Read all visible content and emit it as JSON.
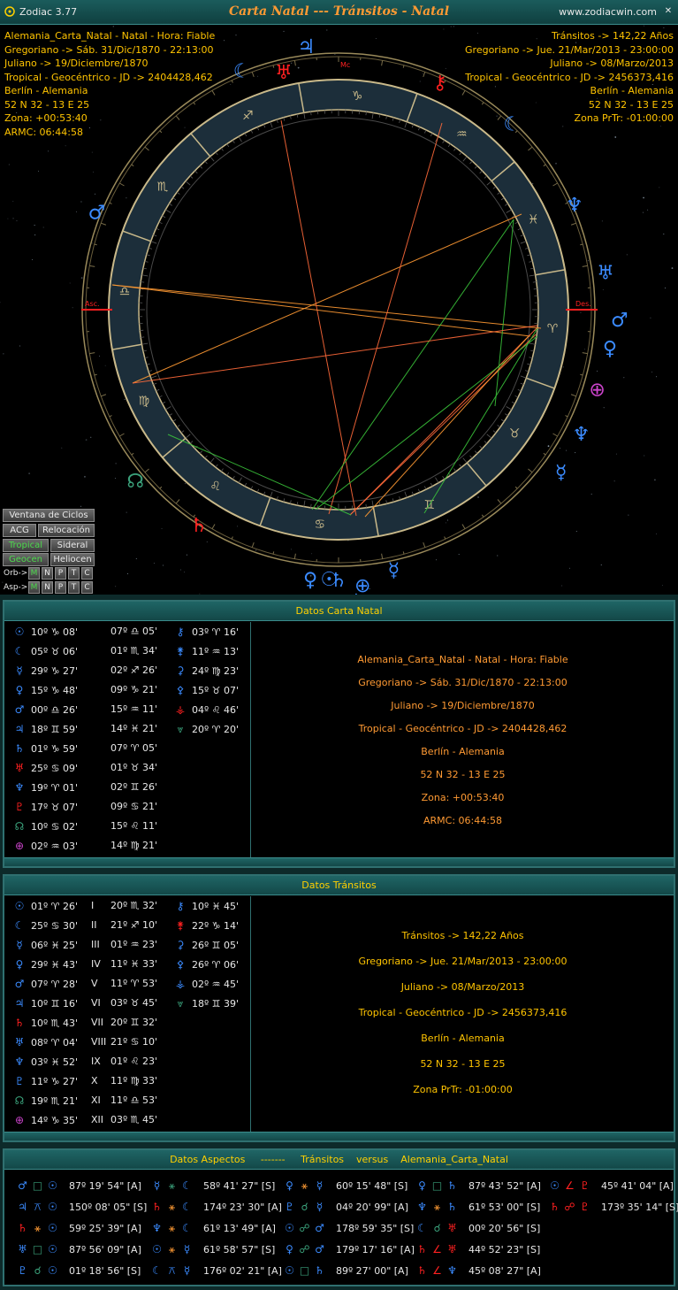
{
  "window": {
    "app_name": "Zodiac 3.77",
    "title": "Carta Natal --- Tránsitos - Natal",
    "site": "www.zodiacwin.com"
  },
  "natal_info": [
    "Alemania_Carta_Natal - Natal - Hora: Fiable",
    "Gregoriano -> Sáb. 31/Dic/1870 - 22:13:00",
    "Juliano -> 19/Diciembre/1870",
    "Tropical - Geocéntrico - JD -> 2404428,462",
    "Berlín - Alemania",
    "52 N 32 - 13 E 25",
    "Zona: +00:53:40",
    "ARMC: 06:44:58"
  ],
  "transit_info": [
    "Tránsitos -> 142,22 Años",
    "Gregoriano -> Jue. 21/Mar/2013 - 23:00:00",
    "Juliano -> 08/Marzo/2013",
    "Tropical - Geocéntrico - JD -> 2456373,416",
    "Berlín - Alemania",
    "52 N 32 - 13 E 25",
    "Zona PrTr: -01:00:00"
  ],
  "wheel": {
    "asc_label": "Asc.",
    "des_label": "Des.",
    "mc_label": "Mc",
    "signs_ccw_from_aries": [
      "♈",
      "♉",
      "♊",
      "♋",
      "♌",
      "♍",
      "♎",
      "♏",
      "♐",
      "♑",
      "♒",
      "♓"
    ],
    "outer_glyphs": [
      {
        "g": "☾",
        "c": "#3b8bff"
      },
      {
        "g": "♅",
        "c": "#ff2020"
      },
      {
        "g": "♃",
        "c": "#3b8bff"
      },
      {
        "g": "⚷",
        "c": "#ff2020"
      },
      {
        "g": "☾",
        "c": "#3b8bff"
      },
      {
        "g": "♆",
        "c": "#3b8bff"
      },
      {
        "g": "♅",
        "c": "#3b8bff"
      },
      {
        "g": "♂",
        "c": "#3b8bff"
      },
      {
        "g": "♀",
        "c": "#3b8bff"
      },
      {
        "g": "⊕",
        "c": "#cc44cc"
      },
      {
        "g": "♆",
        "c": "#3b8bff"
      },
      {
        "g": "☿",
        "c": "#3b8bff"
      },
      {
        "g": "♄",
        "c": "#3b8bff"
      },
      {
        "g": "♄",
        "c": "#3b8bff"
      },
      {
        "g": "☉",
        "c": "#3b8bff"
      },
      {
        "g": "♀",
        "c": "#3b8bff"
      },
      {
        "g": "☿",
        "c": "#3b8bff"
      },
      {
        "g": "⊕",
        "c": "#3b8bff"
      },
      {
        "g": "♄",
        "c": "#ff2020"
      },
      {
        "g": "☊",
        "c": "#3aa07a"
      },
      {
        "g": "♂",
        "c": "#3b8bff"
      }
    ]
  },
  "controls": {
    "ventana": "Ventana de Ciclos",
    "acg": "ACG",
    "relocacion": "Relocación",
    "tropical": "Tropical",
    "sideral": "Sideral",
    "geocen": "Geocen",
    "heliocen": "Heliocen",
    "orb_label": "Orb->",
    "asp_label": "Asp->",
    "toggles": [
      "M",
      "N",
      "P",
      "T",
      "C"
    ]
  },
  "natal_panel": {
    "title": "Datos Carta Natal",
    "col1": [
      {
        "g": "☉",
        "c": "#3b8bff",
        "pos": "10º ♑ 08'"
      },
      {
        "g": "☾",
        "c": "#3b8bff",
        "pos": "05º ♉ 06'"
      },
      {
        "g": "☿",
        "c": "#3b8bff",
        "pos": "29º ♑ 27'"
      },
      {
        "g": "♀",
        "c": "#3b8bff",
        "pos": "15º ♑ 48'"
      },
      {
        "g": "♂",
        "c": "#3b8bff",
        "pos": "00º ♎ 26'"
      },
      {
        "g": "♃",
        "c": "#3b8bff",
        "pos": "18º ♊ 59'"
      },
      {
        "g": "♄",
        "c": "#3b8bff",
        "pos": "01º ♑ 59'"
      },
      {
        "g": "♅",
        "c": "#ff2020",
        "pos": "25º ♋ 09'"
      },
      {
        "g": "♆",
        "c": "#3b8bff",
        "pos": "19º ♈ 01'"
      },
      {
        "g": "♇",
        "c": "#ff2020",
        "pos": "17º ♉ 07'"
      },
      {
        "g": "☊",
        "c": "#3aa07a",
        "pos": "10º ♋ 02'"
      },
      {
        "g": "⊕",
        "c": "#cc44cc",
        "pos": "02º ♒ 03'"
      }
    ],
    "col2": [
      "07º ♎ 05'",
      "01º ♏ 34'",
      "02º ♐ 26'",
      "09º ♑ 21'",
      "15º ♒ 11'",
      "14º ♓ 21'",
      "07º ♈ 05'",
      "01º ♉ 34'",
      "02º ♊ 26'",
      "09º ♋ 21'",
      "15º ♌ 11'",
      "14º ♍ 21'"
    ],
    "col3": [
      {
        "g": "⚷",
        "c": "#3b8bff",
        "pos": "03º ♈ 16'"
      },
      {
        "g": "⚵",
        "c": "#3b8bff",
        "pos": "11º ♒ 13'"
      },
      {
        "g": "⚳",
        "c": "#3b8bff",
        "pos": "24º ♍ 23'"
      },
      {
        "g": "⚴",
        "c": "#3b8bff",
        "pos": "15º ♉ 07'"
      },
      {
        "g": "⚶",
        "c": "#ff2020",
        "pos": "04º ♌ 46'"
      },
      {
        "g": "⩔",
        "c": "#3aa07a",
        "pos": "20º ♈ 20'"
      }
    ],
    "info": [
      "Alemania_Carta_Natal - Natal - Hora: Fiable",
      "Gregoriano -> Sáb. 31/Dic/1870 - 22:13:00",
      "Juliano -> 19/Diciembre/1870",
      "Tropical - Geocéntrico - JD -> 2404428,462",
      "Berlín - Alemania",
      "52 N 32 - 13 E 25",
      "Zona: +00:53:40",
      "ARMC: 06:44:58"
    ]
  },
  "transit_panel": {
    "title": "Datos Tránsitos",
    "col1": [
      {
        "g": "☉",
        "c": "#3b8bff",
        "pos": "01º ♈ 26'"
      },
      {
        "g": "☾",
        "c": "#3b8bff",
        "pos": "25º ♋ 30'"
      },
      {
        "g": "☿",
        "c": "#3b8bff",
        "pos": "06º ♓ 25'"
      },
      {
        "g": "♀",
        "c": "#3b8bff",
        "pos": "29º ♓ 43'"
      },
      {
        "g": "♂",
        "c": "#3b8bff",
        "pos": "07º ♈ 28'"
      },
      {
        "g": "♃",
        "c": "#3b8bff",
        "pos": "10º ♊ 16'"
      },
      {
        "g": "♄",
        "c": "#ff2020",
        "pos": "10º ♏ 43'"
      },
      {
        "g": "♅",
        "c": "#3b8bff",
        "pos": "08º ♈ 04'"
      },
      {
        "g": "♆",
        "c": "#3b8bff",
        "pos": "03º ♓ 52'"
      },
      {
        "g": "♇",
        "c": "#3b8bff",
        "pos": "11º ♑ 27'"
      },
      {
        "g": "☊",
        "c": "#3aa07a",
        "pos": "19º ♏ 21'"
      },
      {
        "g": "⊕",
        "c": "#cc44cc",
        "pos": "14º ♑ 35'"
      }
    ],
    "col2": [
      "20º ♏ 32'",
      "21º ♐ 10'",
      "01º ♒ 23'",
      "11º ♓ 33'",
      "11º ♈ 53'",
      "03º ♉ 45'",
      "20º ♊ 32'",
      "21º ♋ 10'",
      "01º ♌ 23'",
      "11º ♍ 33'",
      "11º ♎ 53'",
      "03º ♏ 45'"
    ],
    "col2_prefix": [
      "I",
      "II",
      "III",
      "IV",
      "V",
      "VI",
      "VII",
      "VIII",
      "IX",
      "X",
      "XI",
      "XII"
    ],
    "col3": [
      {
        "g": "⚷",
        "c": "#3b8bff",
        "pos": "10º ♓ 45'"
      },
      {
        "g": "⚵",
        "c": "#ff2020",
        "pos": "22º ♑ 14'"
      },
      {
        "g": "⚳",
        "c": "#3b8bff",
        "pos": "26º ♊ 05'"
      },
      {
        "g": "⚴",
        "c": "#3b8bff",
        "pos": "26º ♈ 06'"
      },
      {
        "g": "⚶",
        "c": "#3b8bff",
        "pos": "02º ♒ 45'"
      },
      {
        "g": "⩔",
        "c": "#3aa07a",
        "pos": "18º ♊ 39'"
      }
    ],
    "info": [
      "Tránsitos -> 142,22 Años",
      "Gregoriano -> Jue. 21/Mar/2013 - 23:00:00",
      "Juliano -> 08/Marzo/2013",
      "Tropical - Geocéntrico - JD -> 2456373,416",
      "Berlín - Alemania",
      "52 N 32 - 13 E 25",
      "Zona PrTr: -01:00:00"
    ]
  },
  "aspects_panel": {
    "title": "Datos Aspectos     -------     Tránsitos    versus    Alemania_Carta_Natal",
    "rows": [
      [
        {
          "a": "♂",
          "ac": "#3b8bff",
          "s": "□",
          "sc": "#3aa07a",
          "b": "☉",
          "bc": "#3b8bff",
          "v": "87º 19' 54\" [A]"
        },
        {
          "a": "☿",
          "ac": "#3b8bff",
          "s": "⚹",
          "sc": "#3aa07a",
          "b": "☾",
          "bc": "#3b8bff",
          "v": "58º 41' 27\" [S]"
        },
        {
          "a": "♀",
          "ac": "#3b8bff",
          "s": "⚹",
          "sc": "#ff9a33",
          "b": "☿",
          "bc": "#3b8bff",
          "v": "60º 15' 48\" [S]"
        },
        {
          "a": "♀",
          "ac": "#3b8bff",
          "s": "□",
          "sc": "#3aa07a",
          "b": "♄",
          "bc": "#3b8bff",
          "v": "87º 43' 52\" [A]"
        },
        {
          "a": "☉",
          "ac": "#3b8bff",
          "s": "∠",
          "sc": "#ff2020",
          "b": "♇",
          "bc": "#ff2020",
          "v": "45º 41' 04\" [A]"
        }
      ],
      [
        {
          "a": "♃",
          "ac": "#3b8bff",
          "s": "⚻",
          "sc": "#3b8bff",
          "b": "☉",
          "bc": "#3b8bff",
          "v": "150º 08' 05\" [S]"
        },
        {
          "a": "♄",
          "ac": "#ff2020",
          "s": "⚹",
          "sc": "#ff9a33",
          "b": "☾",
          "bc": "#3b8bff",
          "v": "174º 23' 30\" [A]"
        },
        {
          "a": "♇",
          "ac": "#3b8bff",
          "s": "☌",
          "sc": "#3aa07a",
          "b": "☿",
          "bc": "#3b8bff",
          "v": "04º 20' 99\" [A]"
        },
        {
          "a": "♆",
          "ac": "#3b8bff",
          "s": "⚹",
          "sc": "#ff9a33",
          "b": "♄",
          "bc": "#3b8bff",
          "v": "61º 53' 00\" [S]"
        },
        {
          "a": "♄",
          "ac": "#ff2020",
          "s": "☍",
          "sc": "#ff2020",
          "b": "♇",
          "bc": "#ff2020",
          "v": "173º 35' 14\" [S]"
        }
      ],
      [
        {
          "a": "♄",
          "ac": "#ff2020",
          "s": "⚹",
          "sc": "#ff9a33",
          "b": "☉",
          "bc": "#3b8bff",
          "v": "59º 25' 39\" [A]"
        },
        {
          "a": "♆",
          "ac": "#3b8bff",
          "s": "⚹",
          "sc": "#ff9a33",
          "b": "☾",
          "bc": "#3b8bff",
          "v": "61º 13' 49\" [A]"
        },
        {
          "a": "☉",
          "ac": "#3b8bff",
          "s": "☍",
          "sc": "#3aa07a",
          "b": "♂",
          "bc": "#3b8bff",
          "v": "178º 59' 35\" [S]"
        },
        {
          "a": "☾",
          "ac": "#3b8bff",
          "s": "☌",
          "sc": "#3aa07a",
          "b": "♅",
          "bc": "#ff2020",
          "v": "00º 20' 56\" [S]"
        }
      ],
      [
        {
          "a": "♅",
          "ac": "#3b8bff",
          "s": "□",
          "sc": "#3aa07a",
          "b": "☉",
          "bc": "#3b8bff",
          "v": "87º 56' 09\" [A]"
        },
        {
          "a": "☉",
          "ac": "#3b8bff",
          "s": "⚹",
          "sc": "#ff9a33",
          "b": "☿",
          "bc": "#3b8bff",
          "v": "61º 58' 57\" [S]"
        },
        {
          "a": "♀",
          "ac": "#3b8bff",
          "s": "☍",
          "sc": "#3aa07a",
          "b": "♂",
          "bc": "#3b8bff",
          "v": "179º 17' 16\" [A]"
        },
        {
          "a": "♄",
          "ac": "#ff2020",
          "s": "∠",
          "sc": "#ff2020",
          "b": "♅",
          "bc": "#ff2020",
          "v": "44º 52' 23\" [S]"
        }
      ],
      [
        {
          "a": "♇",
          "ac": "#3b8bff",
          "s": "☌",
          "sc": "#3aa07a",
          "b": "☉",
          "bc": "#3b8bff",
          "v": "01º 18' 56\" [S]"
        },
        {
          "a": "☾",
          "ac": "#3b8bff",
          "s": "⚻",
          "sc": "#3b8bff",
          "b": "☿",
          "bc": "#3b8bff",
          "v": "176º 02' 21\" [A]"
        },
        {
          "a": "☉",
          "ac": "#3b8bff",
          "s": "□",
          "sc": "#3aa07a",
          "b": "♄",
          "bc": "#3b8bff",
          "v": "89º 27' 00\" [A]"
        },
        {
          "a": "♄",
          "ac": "#ff2020",
          "s": "∠",
          "sc": "#ff2020",
          "b": "♆",
          "bc": "#3b8bff",
          "v": "45º 08' 27\" [A]"
        }
      ]
    ]
  }
}
